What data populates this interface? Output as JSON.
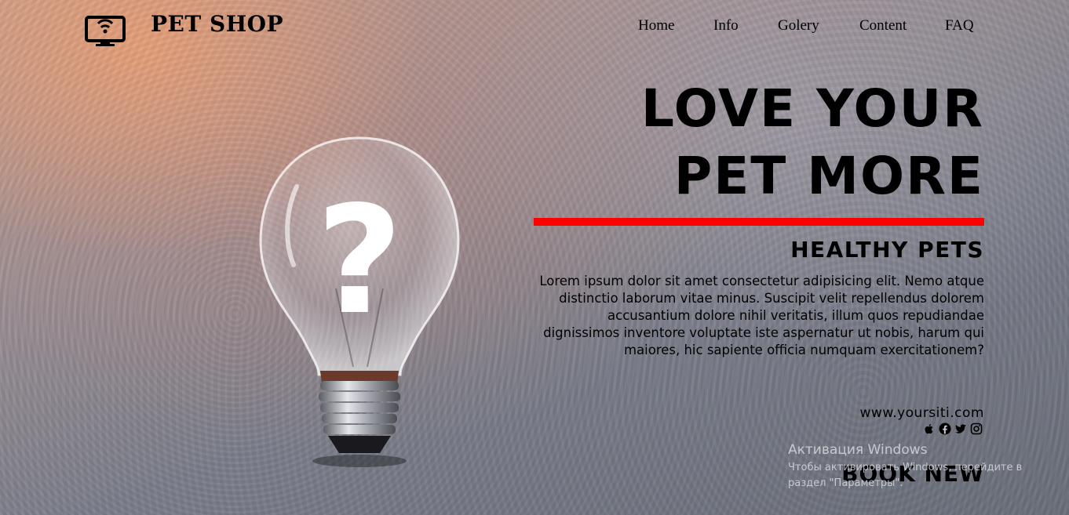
{
  "header": {
    "brand": "PET SHOP",
    "logo_icon": "monitor-wifi-icon",
    "nav": [
      "Home",
      "Info",
      "Golery",
      "Content",
      "FAQ"
    ]
  },
  "hero": {
    "headline_line1": "LOVE YOUR",
    "headline_line2": "PET MORE",
    "subheading": "HEALTHY PETS",
    "description": "Lorem ipsum dolor sit amet consectetur adipisicing elit. Nemo atque distinctio laborum vitae minus. Suscipit velit repellendus dolorem accusantium dolore nihil veritatis, illum quos repudiandae dignissimos inventore voluptate iste aspernatur ut nobis, harum qui maiores, hic sapiente officia numquam exercitationem?",
    "website": "www.yoursiti.com",
    "social_icons": [
      "apple-icon",
      "facebook-icon",
      "twitter-icon",
      "instagram-icon"
    ],
    "cta": "BOOK NEW",
    "accent_color": "#ff0000"
  },
  "overlay": {
    "windows_activation_title": "Активация Windows",
    "windows_activation_text": "Чтобы активировать Windows, перейдите в раздел \"Параметры\"."
  }
}
